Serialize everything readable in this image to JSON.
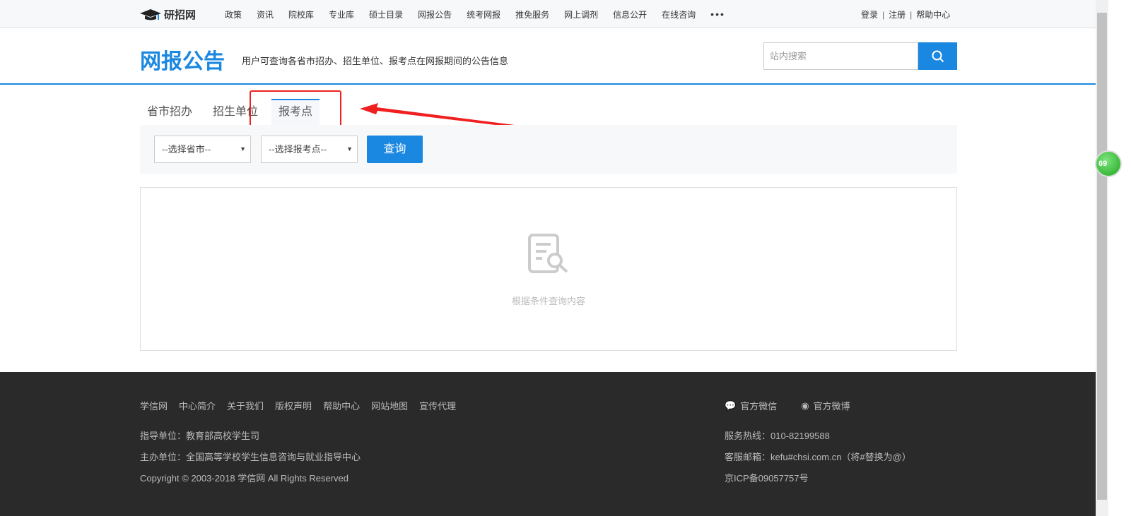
{
  "topbar": {
    "logo": "研招网",
    "nav": [
      "政策",
      "资讯",
      "院校库",
      "专业库",
      "硕士目录",
      "网报公告",
      "统考网报",
      "推免服务",
      "网上调剂",
      "信息公开",
      "在线咨询"
    ],
    "more": "•••",
    "login": "登录",
    "register": "注册",
    "help": "帮助中心"
  },
  "header": {
    "title": "网报公告",
    "subtitle": "用户可查询各省市招办、招生单位、报考点在网报期间的公告信息",
    "search_placeholder": "站内搜索"
  },
  "tabs": [
    {
      "label": "省市招办"
    },
    {
      "label": "招生单位"
    },
    {
      "label": "报考点",
      "active": true
    }
  ],
  "filter": {
    "province": "--选择省市--",
    "site": "--选择报考点--",
    "query": "查询"
  },
  "result": {
    "empty_text": "根据条件查询内容"
  },
  "footer": {
    "links": [
      "学信网",
      "中心简介",
      "关于我们",
      "版权声明",
      "帮助中心",
      "网站地图",
      "宣传代理"
    ],
    "guide": "指导单位：教育部高校学生司",
    "host": "主办单位：全国高等学校学生信息咨询与就业指导中心",
    "copyright": "Copyright © 2003-2018 学信网 All Rights Reserved",
    "wechat": "官方微信",
    "weibo": "官方微博",
    "hotline": "服务热线：010-82199588",
    "email": "客服邮箱：kefu#chsi.com.cn（将#替换为@）",
    "icp": "京ICP备09057757号"
  },
  "widget": {
    "badge": "69"
  },
  "colors": {
    "accent": "#1a87e0",
    "annotation": "#f02020",
    "footer_bg": "#2a2a2a"
  }
}
